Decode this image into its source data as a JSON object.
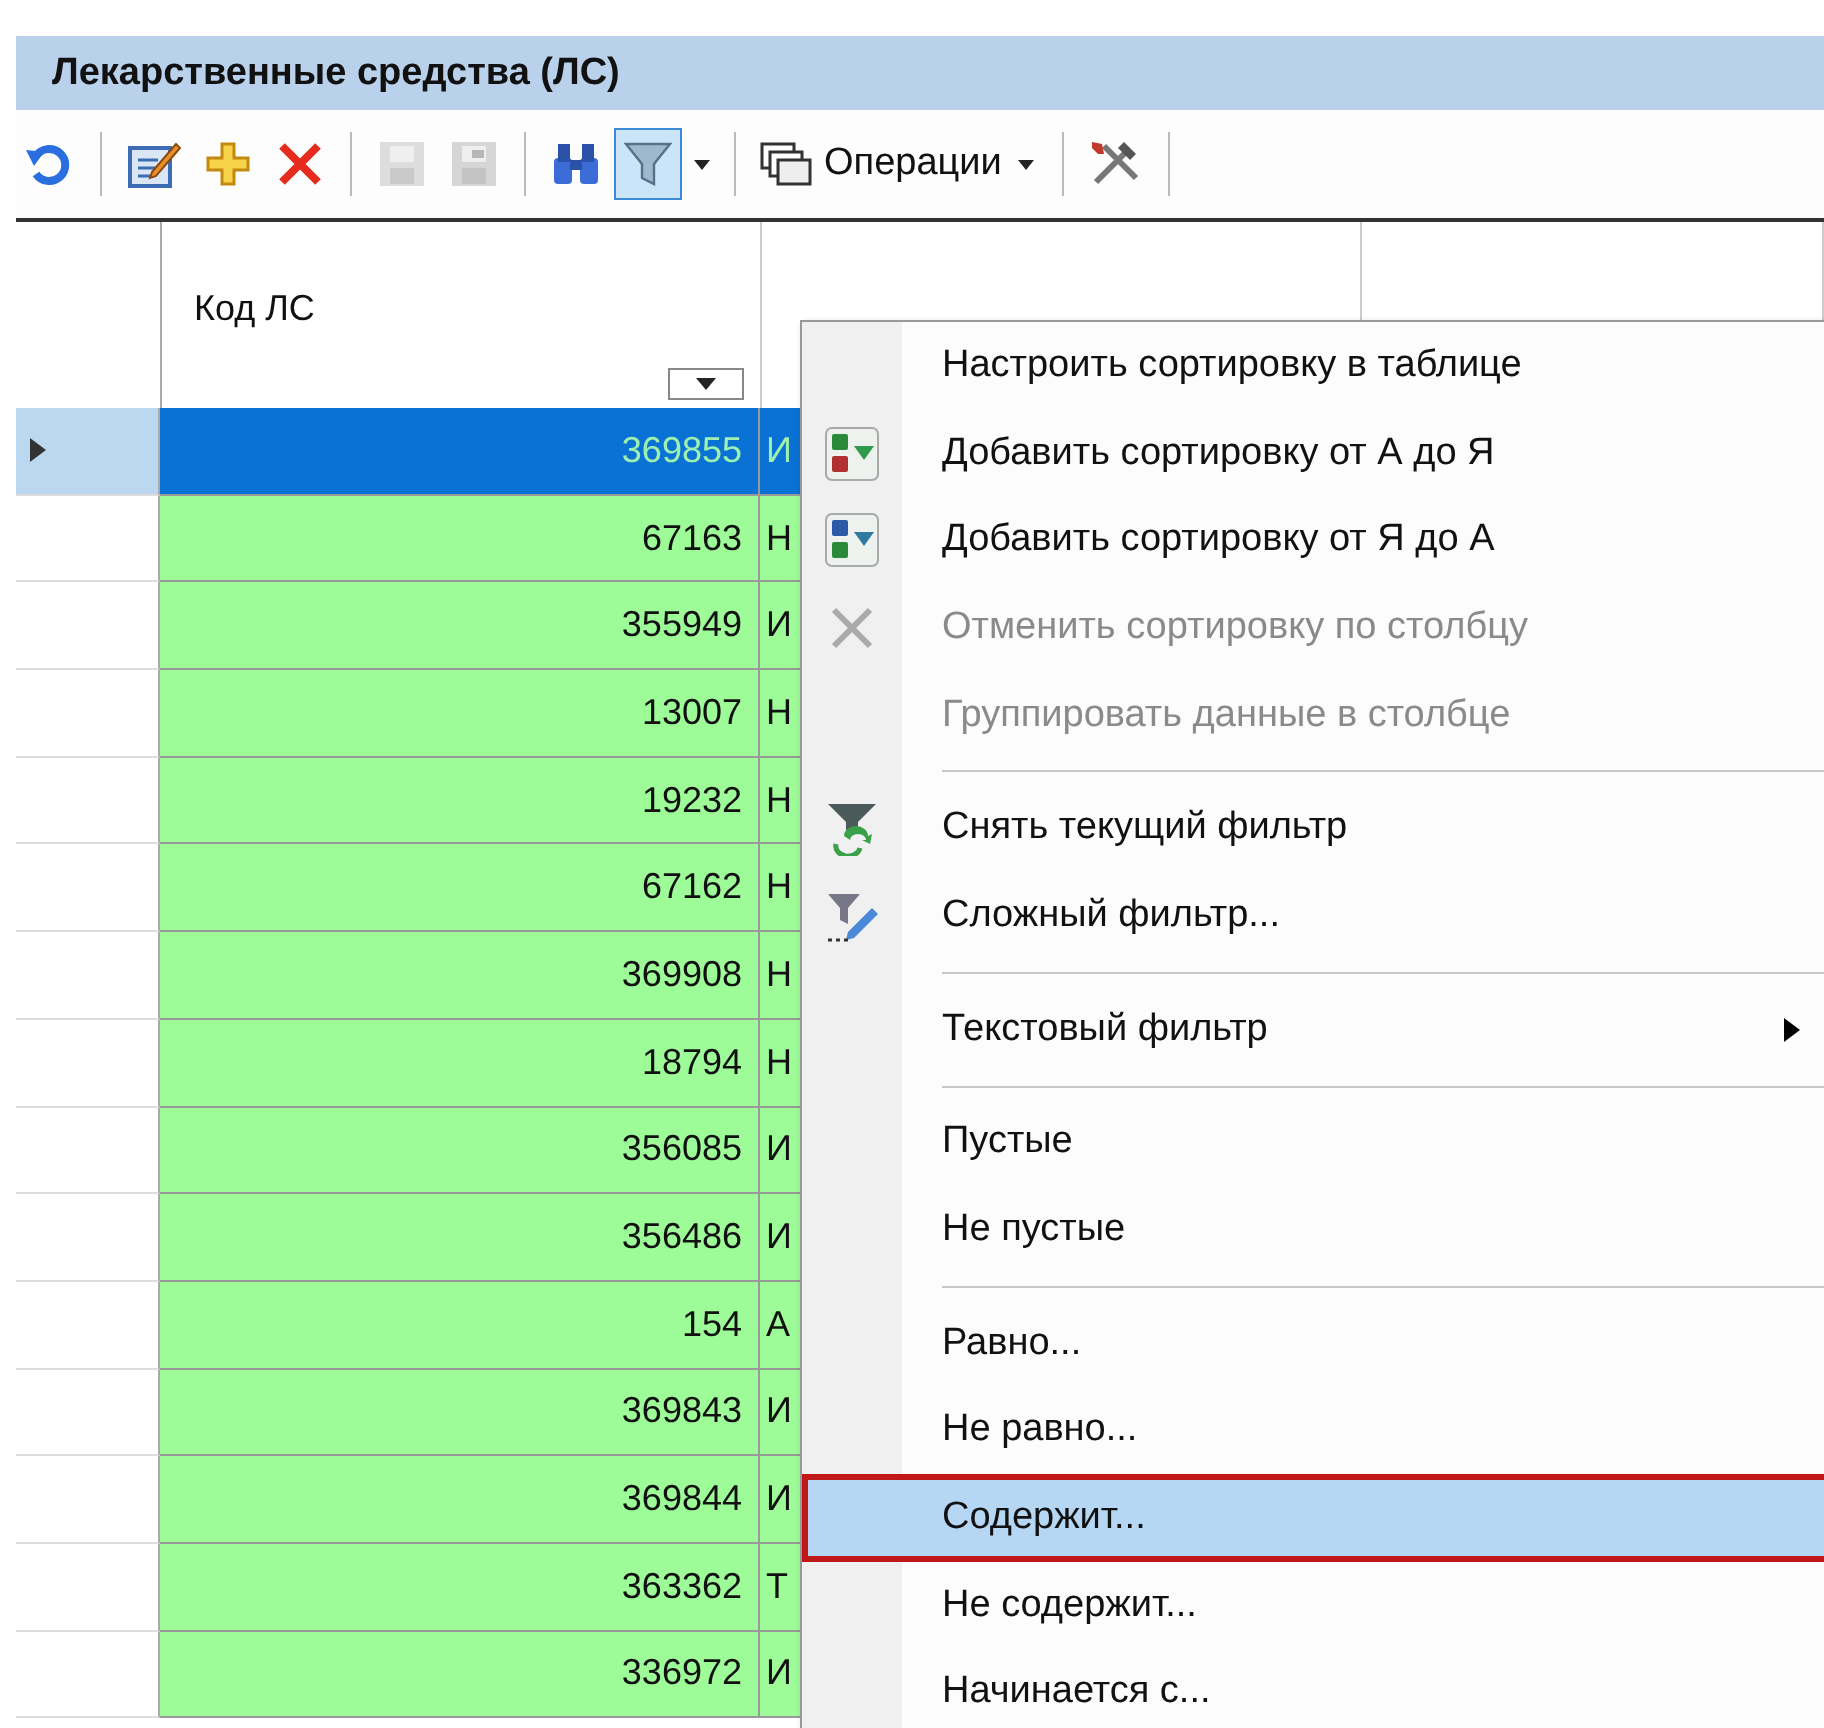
{
  "panel": {
    "title": "Лекарственные средства (ЛС)"
  },
  "toolbar": [
    {
      "kind": "refresh",
      "disabled": false,
      "pressed": false
    },
    {
      "kind": "separator"
    },
    {
      "kind": "edit",
      "disabled": false,
      "pressed": false
    },
    {
      "kind": "add",
      "disabled": false,
      "pressed": false
    },
    {
      "kind": "delete",
      "disabled": false,
      "pressed": false
    },
    {
      "kind": "separator"
    },
    {
      "kind": "save",
      "disabled": true,
      "pressed": false
    },
    {
      "kind": "save-all",
      "disabled": true,
      "pressed": false
    },
    {
      "kind": "separator"
    },
    {
      "kind": "find",
      "disabled": false,
      "pressed": false
    },
    {
      "kind": "filter",
      "disabled": false,
      "pressed": true
    },
    {
      "kind": "dropdown",
      "disabled": false,
      "pressed": false
    },
    {
      "kind": "separator"
    },
    {
      "kind": "operations",
      "label": "Операции",
      "disabled": false,
      "pressed": false
    },
    {
      "kind": "separator"
    },
    {
      "kind": "tools",
      "disabled": false,
      "pressed": false
    },
    {
      "kind": "separator"
    }
  ],
  "grid": {
    "column_1": {
      "label": "Код ЛС"
    },
    "rows": [
      {
        "code": "369855",
        "name": "И",
        "selected": true
      },
      {
        "code": "67163",
        "name": "Н",
        "selected": false
      },
      {
        "code": "355949",
        "name": "И",
        "selected": false
      },
      {
        "code": "13007",
        "name": "Н",
        "selected": false
      },
      {
        "code": "19232",
        "name": "Н",
        "selected": false
      },
      {
        "code": "67162",
        "name": "Н",
        "selected": false
      },
      {
        "code": "369908",
        "name": "Н",
        "selected": false
      },
      {
        "code": "18794",
        "name": "Н",
        "selected": false
      },
      {
        "code": "356085",
        "name": "И",
        "selected": false
      },
      {
        "code": "356486",
        "name": "И",
        "selected": false
      },
      {
        "code": "154",
        "name": "А",
        "selected": false
      },
      {
        "code": "369843",
        "name": "И",
        "selected": false
      },
      {
        "code": "369844",
        "name": "И",
        "selected": false
      },
      {
        "code": "363362",
        "name": "Т",
        "selected": false
      },
      {
        "code": "336972",
        "name": "И",
        "selected": false
      }
    ]
  },
  "context_menu": [
    {
      "kind": "item",
      "label": "Настроить сортировку в таблице",
      "disabled": false,
      "selected": false
    },
    {
      "kind": "item",
      "label": "Добавить сортировку от А до Я",
      "disabled": false,
      "selected": false
    },
    {
      "kind": "item",
      "label": "Добавить сортировку от Я до А",
      "disabled": false,
      "selected": false
    },
    {
      "kind": "item",
      "label": "Отменить сортировку по столбцу",
      "disabled": true,
      "selected": false
    },
    {
      "kind": "item",
      "label": "Группировать данные в столбце",
      "disabled": true,
      "selected": false
    },
    {
      "kind": "separator"
    },
    {
      "kind": "item",
      "label": "Снять текущий фильтр",
      "disabled": false,
      "selected": false
    },
    {
      "kind": "item",
      "label": "Сложный фильтр...",
      "disabled": false,
      "selected": false
    },
    {
      "kind": "separator"
    },
    {
      "kind": "submenu",
      "label": "Текстовый фильтр",
      "disabled": false,
      "selected": false
    },
    {
      "kind": "separator"
    },
    {
      "kind": "item",
      "label": "Пустые",
      "disabled": false,
      "selected": false
    },
    {
      "kind": "item",
      "label": "Не пустые",
      "disabled": false,
      "selected": false
    },
    {
      "kind": "separator"
    },
    {
      "kind": "item",
      "label": "Равно...",
      "disabled": false,
      "selected": false
    },
    {
      "kind": "item",
      "label": "Не равно...",
      "disabled": false,
      "selected": false
    },
    {
      "kind": "item",
      "label": "Содержит...",
      "disabled": false,
      "selected": true
    },
    {
      "kind": "item",
      "label": "Не содержит...",
      "disabled": false,
      "selected": false
    },
    {
      "kind": "item",
      "label": "Начинается с...",
      "disabled": false,
      "selected": false
    }
  ]
}
